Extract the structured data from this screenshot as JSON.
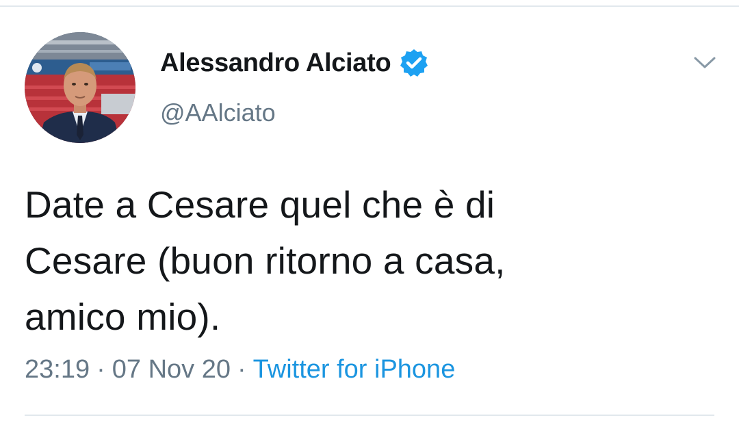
{
  "tweet": {
    "author": {
      "display_name": "Alessandro Alciato",
      "handle": "@AAlciato",
      "verified": true,
      "avatar_icon": "user-avatar-photo"
    },
    "text": "Date a Cesare quel che è di\nCesare (buon ritorno a casa,\namico mio).",
    "time": "23:19",
    "separator": "·",
    "date": "07 Nov 20",
    "source": "Twitter for iPhone",
    "menu_icon": "chevron-down-icon"
  },
  "colors": {
    "text_primary": "#14171a",
    "text_secondary": "#657786",
    "link": "#1b95e0",
    "verified_badge": "#1da1f2",
    "divider": "#e1e8ed"
  }
}
